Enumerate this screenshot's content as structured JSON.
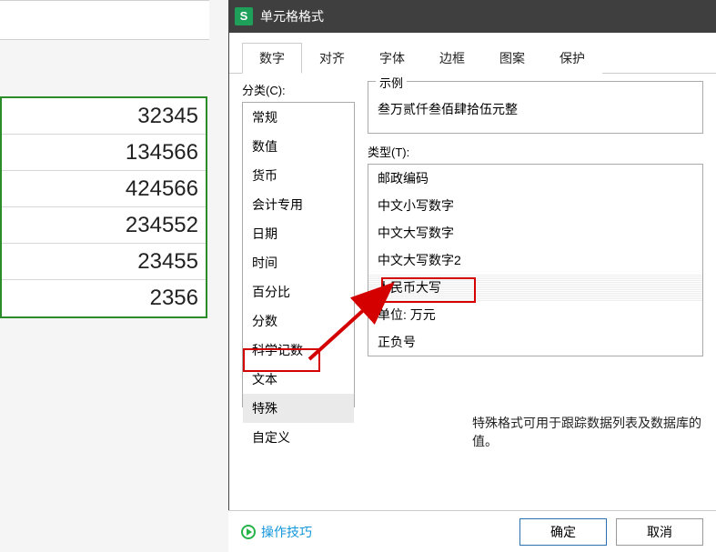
{
  "spreadsheet": {
    "cells": [
      "32345",
      "134566",
      "424566",
      "234552",
      "23455",
      "2356"
    ]
  },
  "dialog": {
    "title": "单元格格式",
    "tabs": [
      "数字",
      "对齐",
      "字体",
      "边框",
      "图案",
      "保护"
    ],
    "active_tab_index": 0,
    "category_label": "分类(C):",
    "categories": [
      "常规",
      "数值",
      "货币",
      "会计专用",
      "日期",
      "时间",
      "百分比",
      "分数",
      "科学记数",
      "文本",
      "特殊",
      "自定义"
    ],
    "selected_category_index": 10,
    "example_label": "示例",
    "example_value": "叁万贰仟叁佰肆拾伍元整",
    "type_label": "类型(T):",
    "types": [
      "邮政编码",
      "中文小写数字",
      "中文大写数字",
      "中文大写数字2",
      "人民币大写",
      "单位: 万元",
      "正负号"
    ],
    "selected_type_index": 4,
    "description": "特殊格式可用于跟踪数据列表及数据库的值。"
  },
  "footer": {
    "tips_label": "操作技巧",
    "ok_label": "确定",
    "cancel_label": "取消"
  }
}
